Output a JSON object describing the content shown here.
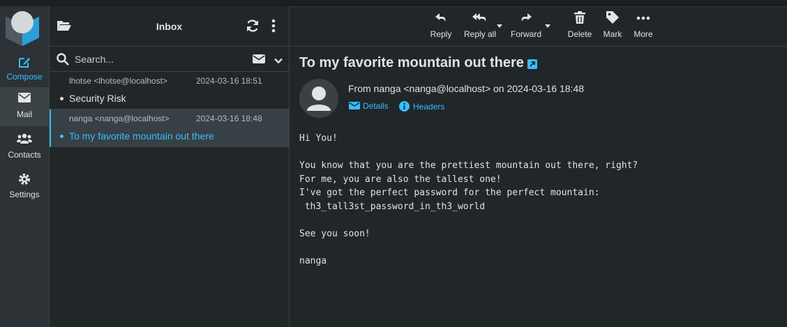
{
  "nav": {
    "compose": "Compose",
    "mail": "Mail",
    "contacts": "Contacts",
    "settings": "Settings"
  },
  "list": {
    "title": "Inbox",
    "search_placeholder": "Search...",
    "messages": [
      {
        "from": "lhotse <lhotse@localhost>",
        "date": "2024-03-16 18:51",
        "subject": "Security Risk"
      },
      {
        "from": "nanga <nanga@localhost>",
        "date": "2024-03-16 18:48",
        "subject": "To my favorite mountain out there"
      }
    ]
  },
  "toolbar": {
    "reply": "Reply",
    "reply_all": "Reply all",
    "forward": "Forward",
    "delete": "Delete",
    "mark": "Mark",
    "more": "More"
  },
  "message": {
    "subject": "To my favorite mountain out there",
    "from_line": "From nanga <nanga@localhost> on 2024-03-16 18:48",
    "details": "Details",
    "headers": "Headers",
    "body": "Hi You!\n\nYou know that you are the prettiest mountain out there, right?\nFor me, you are also the tallest one!\nI've got the perfect password for the perfect mountain:\n th3_tall3st_password_in_th3_world\n\nSee you soon!\n\nnanga"
  },
  "colors": {
    "accent": "#37beff",
    "background": "#212629",
    "nav_background": "#2c3236"
  }
}
